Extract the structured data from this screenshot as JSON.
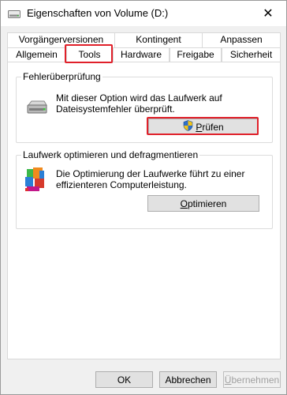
{
  "window": {
    "title": "Eigenschaften von Volume (D:)",
    "close_glyph": "✕"
  },
  "tabs": {
    "row_back": [
      {
        "label": "Vorgängerversionen"
      },
      {
        "label": "Kontingent"
      },
      {
        "label": "Anpassen"
      }
    ],
    "row_front": [
      {
        "label": "Allgemein"
      },
      {
        "label": "Tools"
      },
      {
        "label": "Hardware"
      },
      {
        "label": "Freigabe"
      },
      {
        "label": "Sicherheit"
      }
    ],
    "active": "Tools"
  },
  "error_check": {
    "title": "Fehlerüberprüfung",
    "description": "Mit dieser Option wird das Laufwerk auf Dateisystemfehler überprüft.",
    "button": {
      "pre": "",
      "accel": "P",
      "post": "rüfen"
    },
    "icon": "drive-icon"
  },
  "optimize": {
    "title": "Laufwerk optimieren und defragmentieren",
    "description": "Die Optimierung der Laufwerke führt zu einer effizienteren Computerleistung.",
    "button": {
      "pre": "",
      "accel": "O",
      "post": "ptimieren"
    },
    "icon": "defrag-icon"
  },
  "footer": {
    "ok": "OK",
    "cancel": "Abbrechen",
    "apply": {
      "pre": "",
      "accel": "Ü",
      "post": "bernehmen"
    }
  },
  "colors": {
    "highlight": "#e0202a",
    "shield_blue": "#2f6fc9",
    "shield_yellow": "#f2c318"
  }
}
